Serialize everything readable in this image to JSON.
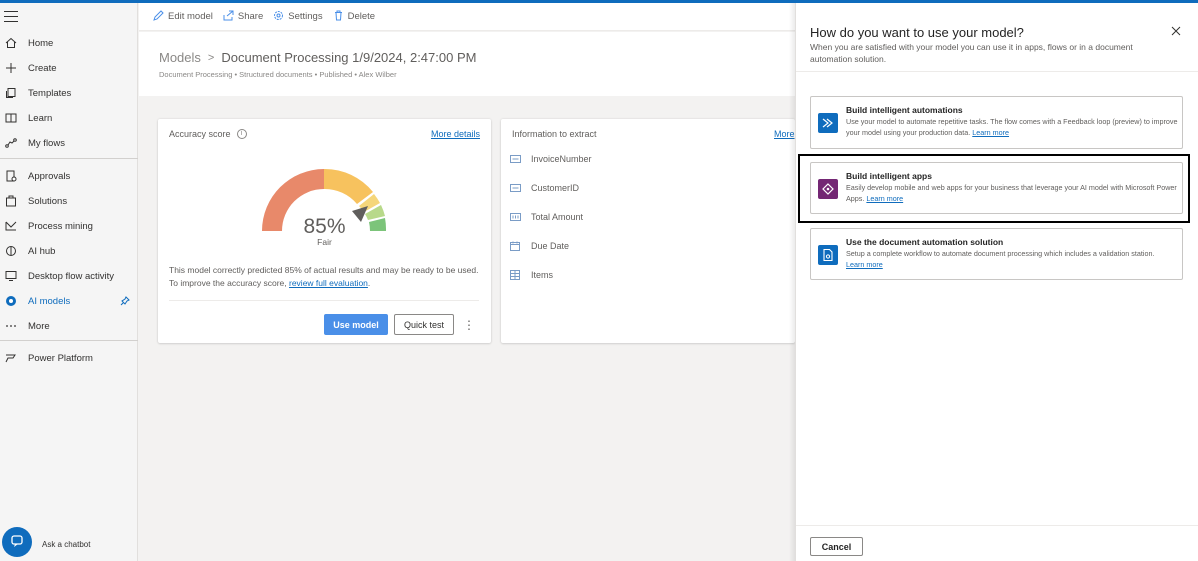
{
  "sidebar": {
    "items": [
      {
        "label": "Home",
        "icon": "home-icon"
      },
      {
        "label": "Create",
        "icon": "plus-icon"
      },
      {
        "label": "Templates",
        "icon": "templates-icon"
      },
      {
        "label": "Learn",
        "icon": "book-icon"
      },
      {
        "label": "My flows",
        "icon": "flows-icon"
      },
      {
        "label": "Approvals",
        "icon": "approvals-icon"
      },
      {
        "label": "Solutions",
        "icon": "solutions-icon"
      },
      {
        "label": "Process mining",
        "icon": "process-mining-icon"
      },
      {
        "label": "AI hub",
        "icon": "ai-hub-icon"
      },
      {
        "label": "Desktop flow activity",
        "icon": "desktop-flow-icon"
      },
      {
        "label": "AI models",
        "icon": "ai-models-icon",
        "active": true
      },
      {
        "label": "More",
        "icon": "more-icon"
      },
      {
        "label": "Power Platform",
        "icon": "power-platform-icon"
      }
    ],
    "chatbot_label": "Ask a chatbot"
  },
  "commandbar": {
    "edit": "Edit model",
    "share": "Share",
    "settings": "Settings",
    "delete": "Delete"
  },
  "header": {
    "breadcrumb_root": "Models",
    "title": "Document Processing 1/9/2024, 2:47:00 PM",
    "subtitle": "Document Processing • Structured documents • Published • Alex Wilber"
  },
  "accuracy": {
    "title": "Accuracy score",
    "more_details": "More details",
    "percent_text": "85%",
    "percent_value": 85,
    "rating": "Fair",
    "description": "This model correctly predicted 85% of actual results and may be ready to be used. To improve the accuracy score, ",
    "description_link": "review full evaluation",
    "description_end": ".",
    "use_model": "Use model",
    "quick_test": "Quick test",
    "colors": {
      "poor": "#e8896a",
      "fair": "#f7c25e",
      "fair_light": "#f5d67a",
      "good_light": "#b8d98a",
      "good": "#7cc47a",
      "needle": "#605e5c"
    }
  },
  "info": {
    "title": "Information to extract",
    "more": "More",
    "fields": [
      {
        "label": "InvoiceNumber",
        "icon": "text-field-icon"
      },
      {
        "label": "CustomerID",
        "icon": "text-field-icon"
      },
      {
        "label": "Total Amount",
        "icon": "number-field-icon"
      },
      {
        "label": "Due Date",
        "icon": "date-field-icon"
      },
      {
        "label": "Items",
        "icon": "table-field-icon"
      }
    ]
  },
  "panel": {
    "title": "How do you want to use your model?",
    "subtitle": "When you are satisfied with your model you can use it in apps, flows or in a document automation solution.",
    "options": [
      {
        "title": "Build intelligent automations",
        "description": "Use your model to automate repetitive tasks. The flow comes with a Feedback loop (preview) to improve your model using your production data. ",
        "link": "Learn more",
        "icon": "power-automate-icon",
        "color": "#0f6cbd"
      },
      {
        "title": "Build intelligent apps",
        "description": "Easily develop mobile and web apps for your business that leverage your AI model with Microsoft Power Apps. ",
        "link": "Learn more",
        "icon": "power-apps-icon",
        "color": "#742774"
      },
      {
        "title": "Use the document automation solution",
        "description": "Setup a complete workflow to automate document processing which includes a validation station.",
        "link": "Learn more",
        "icon": "document-automation-icon",
        "color": "#0f6cbd"
      }
    ],
    "cancel": "Cancel"
  }
}
